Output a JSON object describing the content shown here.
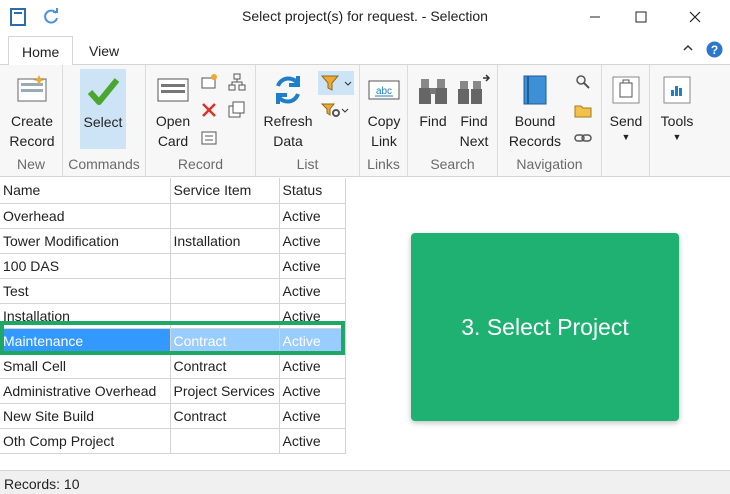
{
  "window": {
    "title": "Select project(s) for request. - Selection",
    "icons": [
      "app-icon",
      "refresh-icon",
      "minimize-icon",
      "maximize-icon",
      "close-icon"
    ]
  },
  "ribbon": {
    "tabs": [
      {
        "label": "Home",
        "active": true
      },
      {
        "label": "View",
        "active": false
      }
    ],
    "groups": {
      "new": {
        "label": "New",
        "create_record": [
          "Create",
          "Record"
        ]
      },
      "commands": {
        "label": "Commands",
        "select": "Select"
      },
      "record": {
        "label": "Record",
        "open_card": [
          "Open",
          "Card"
        ]
      },
      "list": {
        "label": "List",
        "refresh_data": [
          "Refresh",
          "Data"
        ]
      },
      "links": {
        "label": "Links",
        "copy_link": [
          "Copy",
          "Link"
        ]
      },
      "search": {
        "label": "Search",
        "find": "Find",
        "find_next": [
          "Find",
          "Next"
        ]
      },
      "navigation": {
        "label": "Navigation",
        "bound_records": [
          "Bound",
          "Records"
        ]
      },
      "send": {
        "label": "Send"
      },
      "tools": {
        "label": "Tools"
      }
    }
  },
  "grid": {
    "columns": [
      "Name",
      "Service Item",
      "Status"
    ],
    "rows": [
      {
        "name": "Overhead",
        "service": "",
        "status": "Active"
      },
      {
        "name": "Tower Modification",
        "service": "Installation",
        "status": "Active"
      },
      {
        "name": "100 DAS",
        "service": "",
        "status": "Active"
      },
      {
        "name": "Test",
        "service": "",
        "status": "Active"
      },
      {
        "name": "Installation",
        "service": "",
        "status": "Active"
      },
      {
        "name": "Maintenance",
        "service": "Contract",
        "status": "Active",
        "selected": true
      },
      {
        "name": "Small Cell",
        "service": "Contract",
        "status": "Active"
      },
      {
        "name": "Administrative Overhead",
        "service": "Project Services",
        "status": "Active"
      },
      {
        "name": "New Site Build",
        "service": "Contract",
        "status": "Active"
      },
      {
        "name": "Oth Comp Project",
        "service": "",
        "status": "Active"
      }
    ]
  },
  "callout": {
    "text": "3. Select Project",
    "color": "#1eb171"
  },
  "status": {
    "records": "Records: 10"
  },
  "colors": {
    "selection": "#3399ff",
    "highlight_border": "#1fa865",
    "select_button_bg": "#cde4f7"
  }
}
